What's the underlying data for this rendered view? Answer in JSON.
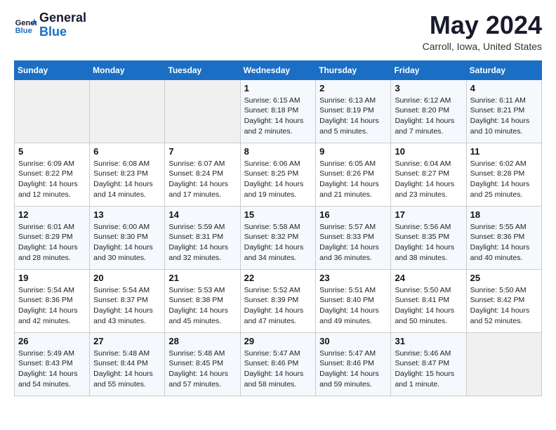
{
  "header": {
    "logo_line1": "General",
    "logo_line2": "Blue",
    "month_title": "May 2024",
    "location": "Carroll, Iowa, United States"
  },
  "weekdays": [
    "Sunday",
    "Monday",
    "Tuesday",
    "Wednesday",
    "Thursday",
    "Friday",
    "Saturday"
  ],
  "weeks": [
    [
      {
        "day": "",
        "info": ""
      },
      {
        "day": "",
        "info": ""
      },
      {
        "day": "",
        "info": ""
      },
      {
        "day": "1",
        "info": "Sunrise: 6:15 AM\nSunset: 8:18 PM\nDaylight: 14 hours\nand 2 minutes."
      },
      {
        "day": "2",
        "info": "Sunrise: 6:13 AM\nSunset: 8:19 PM\nDaylight: 14 hours\nand 5 minutes."
      },
      {
        "day": "3",
        "info": "Sunrise: 6:12 AM\nSunset: 8:20 PM\nDaylight: 14 hours\nand 7 minutes."
      },
      {
        "day": "4",
        "info": "Sunrise: 6:11 AM\nSunset: 8:21 PM\nDaylight: 14 hours\nand 10 minutes."
      }
    ],
    [
      {
        "day": "5",
        "info": "Sunrise: 6:09 AM\nSunset: 8:22 PM\nDaylight: 14 hours\nand 12 minutes."
      },
      {
        "day": "6",
        "info": "Sunrise: 6:08 AM\nSunset: 8:23 PM\nDaylight: 14 hours\nand 14 minutes."
      },
      {
        "day": "7",
        "info": "Sunrise: 6:07 AM\nSunset: 8:24 PM\nDaylight: 14 hours\nand 17 minutes."
      },
      {
        "day": "8",
        "info": "Sunrise: 6:06 AM\nSunset: 8:25 PM\nDaylight: 14 hours\nand 19 minutes."
      },
      {
        "day": "9",
        "info": "Sunrise: 6:05 AM\nSunset: 8:26 PM\nDaylight: 14 hours\nand 21 minutes."
      },
      {
        "day": "10",
        "info": "Sunrise: 6:04 AM\nSunset: 8:27 PM\nDaylight: 14 hours\nand 23 minutes."
      },
      {
        "day": "11",
        "info": "Sunrise: 6:02 AM\nSunset: 8:28 PM\nDaylight: 14 hours\nand 25 minutes."
      }
    ],
    [
      {
        "day": "12",
        "info": "Sunrise: 6:01 AM\nSunset: 8:29 PM\nDaylight: 14 hours\nand 28 minutes."
      },
      {
        "day": "13",
        "info": "Sunrise: 6:00 AM\nSunset: 8:30 PM\nDaylight: 14 hours\nand 30 minutes."
      },
      {
        "day": "14",
        "info": "Sunrise: 5:59 AM\nSunset: 8:31 PM\nDaylight: 14 hours\nand 32 minutes."
      },
      {
        "day": "15",
        "info": "Sunrise: 5:58 AM\nSunset: 8:32 PM\nDaylight: 14 hours\nand 34 minutes."
      },
      {
        "day": "16",
        "info": "Sunrise: 5:57 AM\nSunset: 8:33 PM\nDaylight: 14 hours\nand 36 minutes."
      },
      {
        "day": "17",
        "info": "Sunrise: 5:56 AM\nSunset: 8:35 PM\nDaylight: 14 hours\nand 38 minutes."
      },
      {
        "day": "18",
        "info": "Sunrise: 5:55 AM\nSunset: 8:36 PM\nDaylight: 14 hours\nand 40 minutes."
      }
    ],
    [
      {
        "day": "19",
        "info": "Sunrise: 5:54 AM\nSunset: 8:36 PM\nDaylight: 14 hours\nand 42 minutes."
      },
      {
        "day": "20",
        "info": "Sunrise: 5:54 AM\nSunset: 8:37 PM\nDaylight: 14 hours\nand 43 minutes."
      },
      {
        "day": "21",
        "info": "Sunrise: 5:53 AM\nSunset: 8:38 PM\nDaylight: 14 hours\nand 45 minutes."
      },
      {
        "day": "22",
        "info": "Sunrise: 5:52 AM\nSunset: 8:39 PM\nDaylight: 14 hours\nand 47 minutes."
      },
      {
        "day": "23",
        "info": "Sunrise: 5:51 AM\nSunset: 8:40 PM\nDaylight: 14 hours\nand 49 minutes."
      },
      {
        "day": "24",
        "info": "Sunrise: 5:50 AM\nSunset: 8:41 PM\nDaylight: 14 hours\nand 50 minutes."
      },
      {
        "day": "25",
        "info": "Sunrise: 5:50 AM\nSunset: 8:42 PM\nDaylight: 14 hours\nand 52 minutes."
      }
    ],
    [
      {
        "day": "26",
        "info": "Sunrise: 5:49 AM\nSunset: 8:43 PM\nDaylight: 14 hours\nand 54 minutes."
      },
      {
        "day": "27",
        "info": "Sunrise: 5:48 AM\nSunset: 8:44 PM\nDaylight: 14 hours\nand 55 minutes."
      },
      {
        "day": "28",
        "info": "Sunrise: 5:48 AM\nSunset: 8:45 PM\nDaylight: 14 hours\nand 57 minutes."
      },
      {
        "day": "29",
        "info": "Sunrise: 5:47 AM\nSunset: 8:46 PM\nDaylight: 14 hours\nand 58 minutes."
      },
      {
        "day": "30",
        "info": "Sunrise: 5:47 AM\nSunset: 8:46 PM\nDaylight: 14 hours\nand 59 minutes."
      },
      {
        "day": "31",
        "info": "Sunrise: 5:46 AM\nSunset: 8:47 PM\nDaylight: 15 hours\nand 1 minute."
      },
      {
        "day": "",
        "info": ""
      }
    ]
  ]
}
